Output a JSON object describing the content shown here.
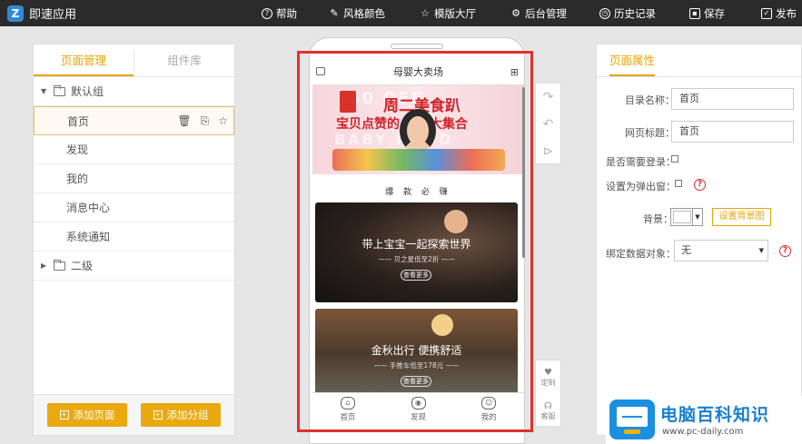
{
  "app": {
    "name": "即速应用",
    "logo_letter": "Z"
  },
  "toolbar": {
    "help": "帮助",
    "style_color": "风格颜色",
    "templates": "模版大厅",
    "backend": "后台管理",
    "history": "历史记录",
    "save": "保存",
    "publish": "发布"
  },
  "left_panel": {
    "tabs": [
      "页面管理",
      "组件库"
    ],
    "groups": [
      {
        "label": "默认组",
        "expanded": true,
        "pages": [
          "首页",
          "发现",
          "我的",
          "消息中心",
          "系统通知"
        ]
      },
      {
        "label": "二级",
        "expanded": false,
        "pages": []
      }
    ],
    "selected_page": "首页",
    "add_page_label": "添加页面",
    "add_group_label": "添加分组"
  },
  "phone": {
    "header_title": "母婴大卖场",
    "banner": {
      "headline": "周二美食趴",
      "subline": "宝贝点赞的 美味大集合",
      "bg_text_top": "50  OFF",
      "bg_text_bottom": "BABY  FOOD"
    },
    "section_title": "爆 款 必 赚",
    "cards": [
      {
        "title": "带上宝宝一起探索世界",
        "subtitle": "—— 贝之星低至2折 ——",
        "button": "查看更多"
      },
      {
        "title": "金秋出行 便携舒适",
        "subtitle": "—— 手推车低至178元 ——",
        "button": "查看更多"
      }
    ],
    "nav": [
      {
        "label": "首页",
        "icon": "home-icon"
      },
      {
        "label": "发现",
        "icon": "discover-icon"
      },
      {
        "label": "我的",
        "icon": "profile-icon"
      }
    ]
  },
  "side_tools": {
    "redo_icon": "redo-icon",
    "undo_icon": "undo-icon",
    "preview_icon": "preview-icon",
    "customize_label": "定制",
    "service_label": "客服"
  },
  "right_panel": {
    "title": "页面属性",
    "menu_name_label": "目录名称：",
    "menu_name_value": "首页",
    "page_title_label": "网页标题：",
    "page_title_value": "首页",
    "need_login_label": "是否需要登录：",
    "popup_label": "设置为弹出窗：",
    "background_label": "背景：",
    "set_bg_image_button": "设置背景图",
    "bind_data_label": "绑定数据对象：",
    "bind_data_value": "无"
  },
  "watermark": {
    "title": "电脑百科知识",
    "url": "www.pc-daily.com"
  },
  "colors": {
    "accent": "#e6a40a",
    "topbar": "#2b2b2b",
    "highlight_frame": "#e0322c"
  }
}
